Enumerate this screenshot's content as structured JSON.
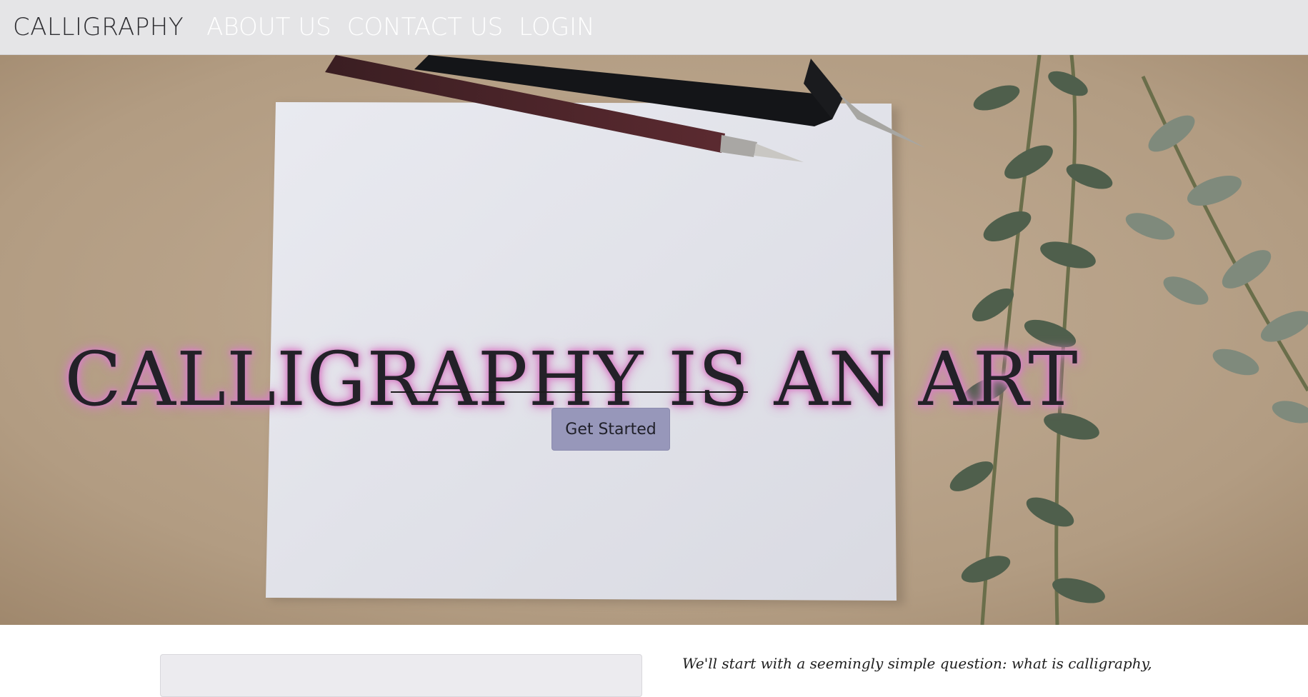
{
  "navbar": {
    "brand": "CALLIGRAPHY",
    "links": [
      "ABOUT US",
      "CONTACT US",
      "LOGIN"
    ]
  },
  "hero": {
    "title": "CALLIGRAPHY IS AN ART",
    "cta_label": "Get Started"
  },
  "content": {
    "intro_text": "We'll start with a seemingly simple question: what is calligraphy,"
  },
  "colors": {
    "navbar_bg": "#e5e5e7",
    "title_glow": "#d77fc6",
    "button_bg": "#9797ba"
  }
}
